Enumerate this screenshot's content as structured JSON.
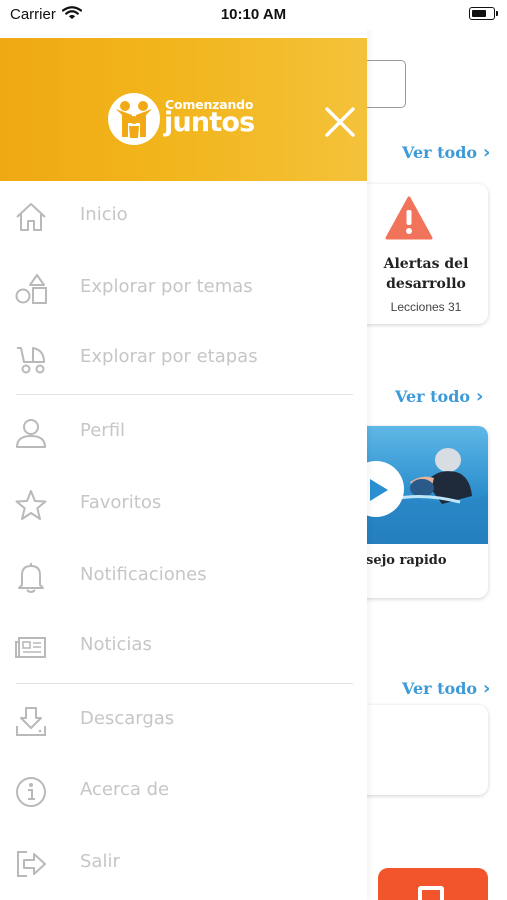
{
  "status_bar": {
    "carrier": "Carrier",
    "time": "10:10 AM",
    "battery_level": 0.8
  },
  "background": {
    "sections": [
      {
        "see_all": "Ver todo",
        "chevron": "›"
      },
      {
        "see_all": "Ver todo",
        "chevron": "›"
      },
      {
        "see_all": "Ver todo",
        "chevron": "›"
      }
    ],
    "alert_card": {
      "title": "Alertas del desarrollo",
      "lessons": "Lecciones 31",
      "icon": "warning-icon",
      "accent": "#f0735a"
    },
    "video_card": {
      "caption": "sejo rapido",
      "icon": "play-icon"
    }
  },
  "drawer": {
    "brand": {
      "line1": "Comenzando",
      "line2": "juntos",
      "color": "#f2b51c"
    },
    "close_icon": "close-icon",
    "items": [
      {
        "label": "Inicio",
        "icon": "home-icon"
      },
      {
        "label": "Explorar por temas",
        "icon": "shapes-icon"
      },
      {
        "label": "Explorar por etapas",
        "icon": "stroller-icon"
      },
      {
        "label": "Perfil",
        "icon": "user-icon"
      },
      {
        "label": "Favoritos",
        "icon": "star-icon"
      },
      {
        "label": "Notificaciones",
        "icon": "bell-icon"
      },
      {
        "label": "Noticias",
        "icon": "newspaper-icon"
      },
      {
        "label": "Descargas",
        "icon": "download-icon"
      },
      {
        "label": "Acerca de",
        "icon": "info-icon"
      },
      {
        "label": "Salir",
        "icon": "logout-icon"
      }
    ]
  }
}
